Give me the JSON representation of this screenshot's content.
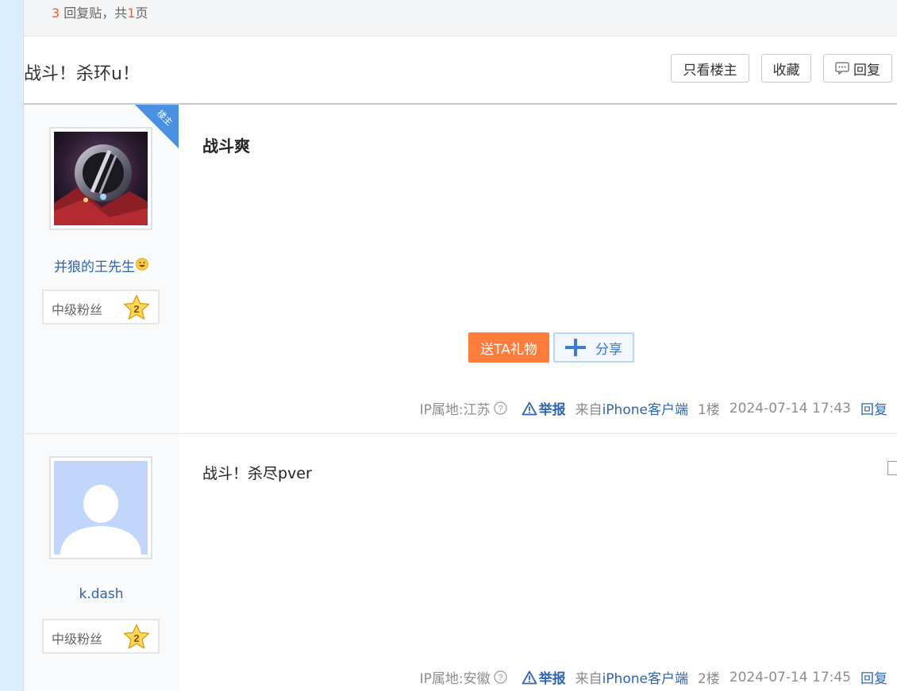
{
  "stats": {
    "reply_count": "3",
    "reply_text": "回复贴，共",
    "page_count": "1",
    "page_unit": "页"
  },
  "thread": {
    "title": "战斗！杀环u！",
    "buttons": {
      "only_op": "只看楼主",
      "favorite": "收藏",
      "reply": "回复"
    }
  },
  "posts": [
    {
      "badge": "楼主",
      "username": "并狼的王先生",
      "level_label": "中级粉丝",
      "level": "2",
      "content": "战斗爽",
      "gift_label": "送TA礼物",
      "share_label": "分享",
      "ip": "IP属地:江苏",
      "report_label": "举报",
      "from_prefix": "来自",
      "client": "iPhone客户端",
      "floor": "1楼",
      "time": "2024-07-14 17:43",
      "reply_label": "回复"
    },
    {
      "username": "k.dash",
      "level_label": "中级粉丝",
      "level": "2",
      "content": "战斗！杀尽pver",
      "ip": "IP属地:安徽",
      "report_label": "举报",
      "from_prefix": "来自",
      "client": "iPhone客户端",
      "floor": "2楼",
      "time": "2024-07-14 17:45",
      "reply_label": "回复"
    }
  ],
  "colors": {
    "accent": "#ff5a1f",
    "link": "#2d64b3",
    "gift": "#ff7d3b",
    "badge": "#4a90e2",
    "sidebar": "#dbeeff"
  },
  "icons": [
    "reply-icon",
    "smile-icon",
    "level-star-icon",
    "share-plus-icon",
    "question-icon",
    "warning-icon",
    "dropdown-icon"
  ]
}
